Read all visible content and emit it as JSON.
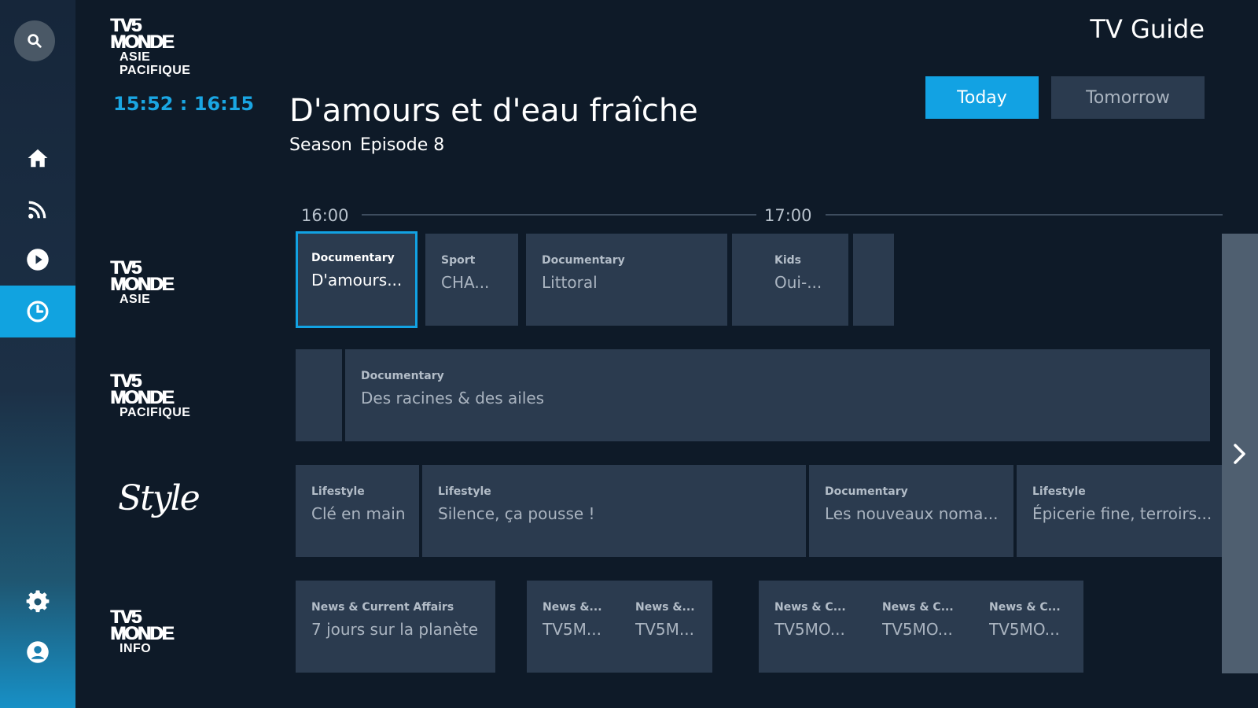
{
  "header": {
    "title": "TV Guide",
    "today_label": "Today",
    "tomorrow_label": "Tomorrow"
  },
  "current": {
    "channel_logo": {
      "brand": "TV5\nMONDE",
      "sub": "ASIE\nPACIFIQUE"
    },
    "time_range": "15:52 : 16:15",
    "title": "D'amours et d'eau fraîche",
    "season_label": "Season",
    "episode_label": "Episode 8"
  },
  "timeline": {
    "labels": [
      "16:00",
      "17:00"
    ]
  },
  "channels": [
    {
      "logo_brand": "TV5\nMONDE",
      "logo_sub": "ASIE",
      "programs": [
        {
          "category": "Documentary",
          "title": "D'amours...",
          "selected": true
        },
        {
          "category": "Sport",
          "title": "CHA..."
        },
        {
          "category": "Documentary",
          "title": "Littoral"
        },
        {
          "category": "Kids",
          "title": "Oui-..."
        },
        {
          "category": "",
          "title": ""
        }
      ]
    },
    {
      "logo_brand": "TV5\nMONDE",
      "logo_sub": "PACIFIQUE",
      "programs": [
        {
          "category": "",
          "title": ""
        },
        {
          "category": "Documentary",
          "title": "Des racines & des ailes"
        }
      ]
    },
    {
      "logo_text": "Style",
      "programs": [
        {
          "category": "Lifestyle",
          "title": "Clé en main"
        },
        {
          "category": "Lifestyle",
          "title": "Silence, ça pousse !"
        },
        {
          "category": "Documentary",
          "title": "Les nouveaux noma..."
        },
        {
          "category": "Lifestyle",
          "title": "Épicerie fine, terroirs..."
        }
      ]
    },
    {
      "logo_brand": "TV5\nMONDE",
      "logo_sub": "INFO",
      "programs": [
        {
          "category": "News & Current Affairs",
          "title": "7 jours sur la planète"
        },
        {
          "category": "News &...",
          "title": "TV5M..."
        },
        {
          "category": "News &...",
          "title": "TV5M..."
        },
        {
          "category": "News & C...",
          "title": "TV5MO..."
        },
        {
          "category": "News & C...",
          "title": "TV5MO..."
        },
        {
          "category": "News & C...",
          "title": "TV5MO..."
        }
      ]
    }
  ],
  "sidebar": {
    "items": [
      "search-icon",
      "home-icon",
      "feed-icon",
      "play-icon",
      "clock-icon",
      "settings-icon",
      "profile-icon"
    ],
    "active": "clock-icon"
  },
  "colors": {
    "accent": "#12a2e3",
    "background": "#0e1a28",
    "cell": "#2b3b4f"
  }
}
